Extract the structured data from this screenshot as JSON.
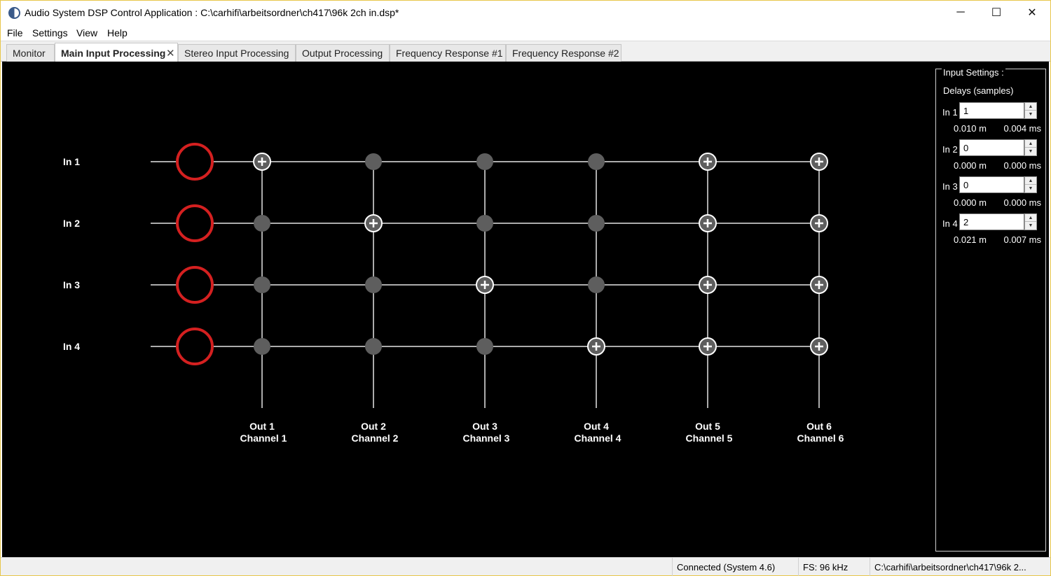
{
  "window": {
    "title": "Audio System DSP Control Application : C:\\carhifi\\arbeitsordner\\ch417\\96k 2ch in.dsp*",
    "icon": "app-logo-icon",
    "minimize_glyph": "─",
    "maximize_glyph": "☐",
    "close_glyph": "✕"
  },
  "menu": [
    "File",
    "Settings",
    "View",
    "Help"
  ],
  "tabs": [
    {
      "label": "Monitor",
      "active": false
    },
    {
      "label": "Main Input Processing",
      "active": true,
      "close": "✕"
    },
    {
      "label": "Stereo Input Processing",
      "active": false
    },
    {
      "label": "Output Processing",
      "active": false
    },
    {
      "label": "Frequency Response #1",
      "active": false
    },
    {
      "label": "Frequency Response #2",
      "active": false
    }
  ],
  "matrix": {
    "inputs": [
      "In 1",
      "In 2",
      "In 3",
      "In 4"
    ],
    "outputs": [
      {
        "out": "Out 1",
        "channel": "Channel 1"
      },
      {
        "out": "Out 2",
        "channel": "Channel 2"
      },
      {
        "out": "Out 3",
        "channel": "Channel 3"
      },
      {
        "out": "Out 4",
        "channel": "Channel 4"
      },
      {
        "out": "Out 5",
        "channel": "Channel 5"
      },
      {
        "out": "Out 6",
        "channel": "Channel 6"
      }
    ],
    "routing": [
      [
        1,
        0,
        0,
        0,
        1,
        1
      ],
      [
        0,
        1,
        0,
        0,
        1,
        1
      ],
      [
        0,
        0,
        1,
        0,
        1,
        1
      ],
      [
        0,
        0,
        0,
        1,
        1,
        1
      ]
    ],
    "colors": {
      "line": "#e6e6e6",
      "node_off": "#5e5e5e",
      "node_on": "#5e5e5e",
      "plus": "#ffffff",
      "input_ring": "#d42020",
      "label": "#ffffff"
    }
  },
  "input_settings": {
    "legend": "Input Settings :",
    "subtitle": "Delays (samples)",
    "delays": [
      {
        "label": "In 1",
        "value": "1",
        "meters": "0.010 m",
        "ms": "0.004 ms"
      },
      {
        "label": "In 2",
        "value": "0",
        "meters": "0.000 m",
        "ms": "0.000 ms"
      },
      {
        "label": "In 3",
        "value": "0",
        "meters": "0.000 m",
        "ms": "0.000 ms"
      },
      {
        "label": "In 4",
        "value": "2",
        "meters": "0.021 m",
        "ms": "0.007 ms"
      }
    ],
    "spin_up": "▲",
    "spin_down": "▼"
  },
  "status": {
    "connection": "Connected (System 4.6)",
    "fs": "FS: 96 kHz",
    "path": "C:\\carhifi\\arbeitsordner\\ch417\\96k 2..."
  }
}
